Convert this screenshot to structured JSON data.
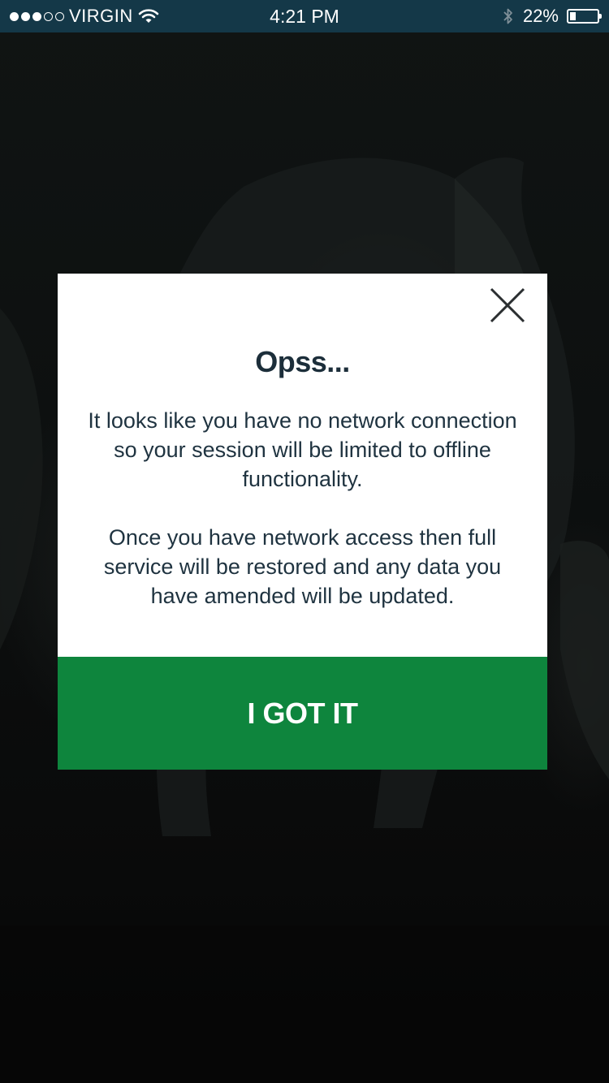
{
  "status_bar": {
    "carrier": "VIRGIN",
    "signal_bars_filled": 3,
    "signal_bars_total": 5,
    "time": "4:21 PM",
    "battery_percent": "22%",
    "battery_level": 0.22,
    "icons": [
      "wifi-icon",
      "bluetooth-icon",
      "battery-icon"
    ]
  },
  "dialog": {
    "title": "Opss...",
    "message_1": "It looks like you have no network connection so your session will be limited to offline functionality.",
    "message_2": "Once you have network access then full service will be restored and any data you have amended will be updated.",
    "confirm_label": "I GOT IT",
    "close_icon": "close-icon"
  },
  "colors": {
    "status_bar": "#143848",
    "accent_green": "#0e853d",
    "title_text": "#1c2e3a",
    "body_text": "#1f3340"
  }
}
